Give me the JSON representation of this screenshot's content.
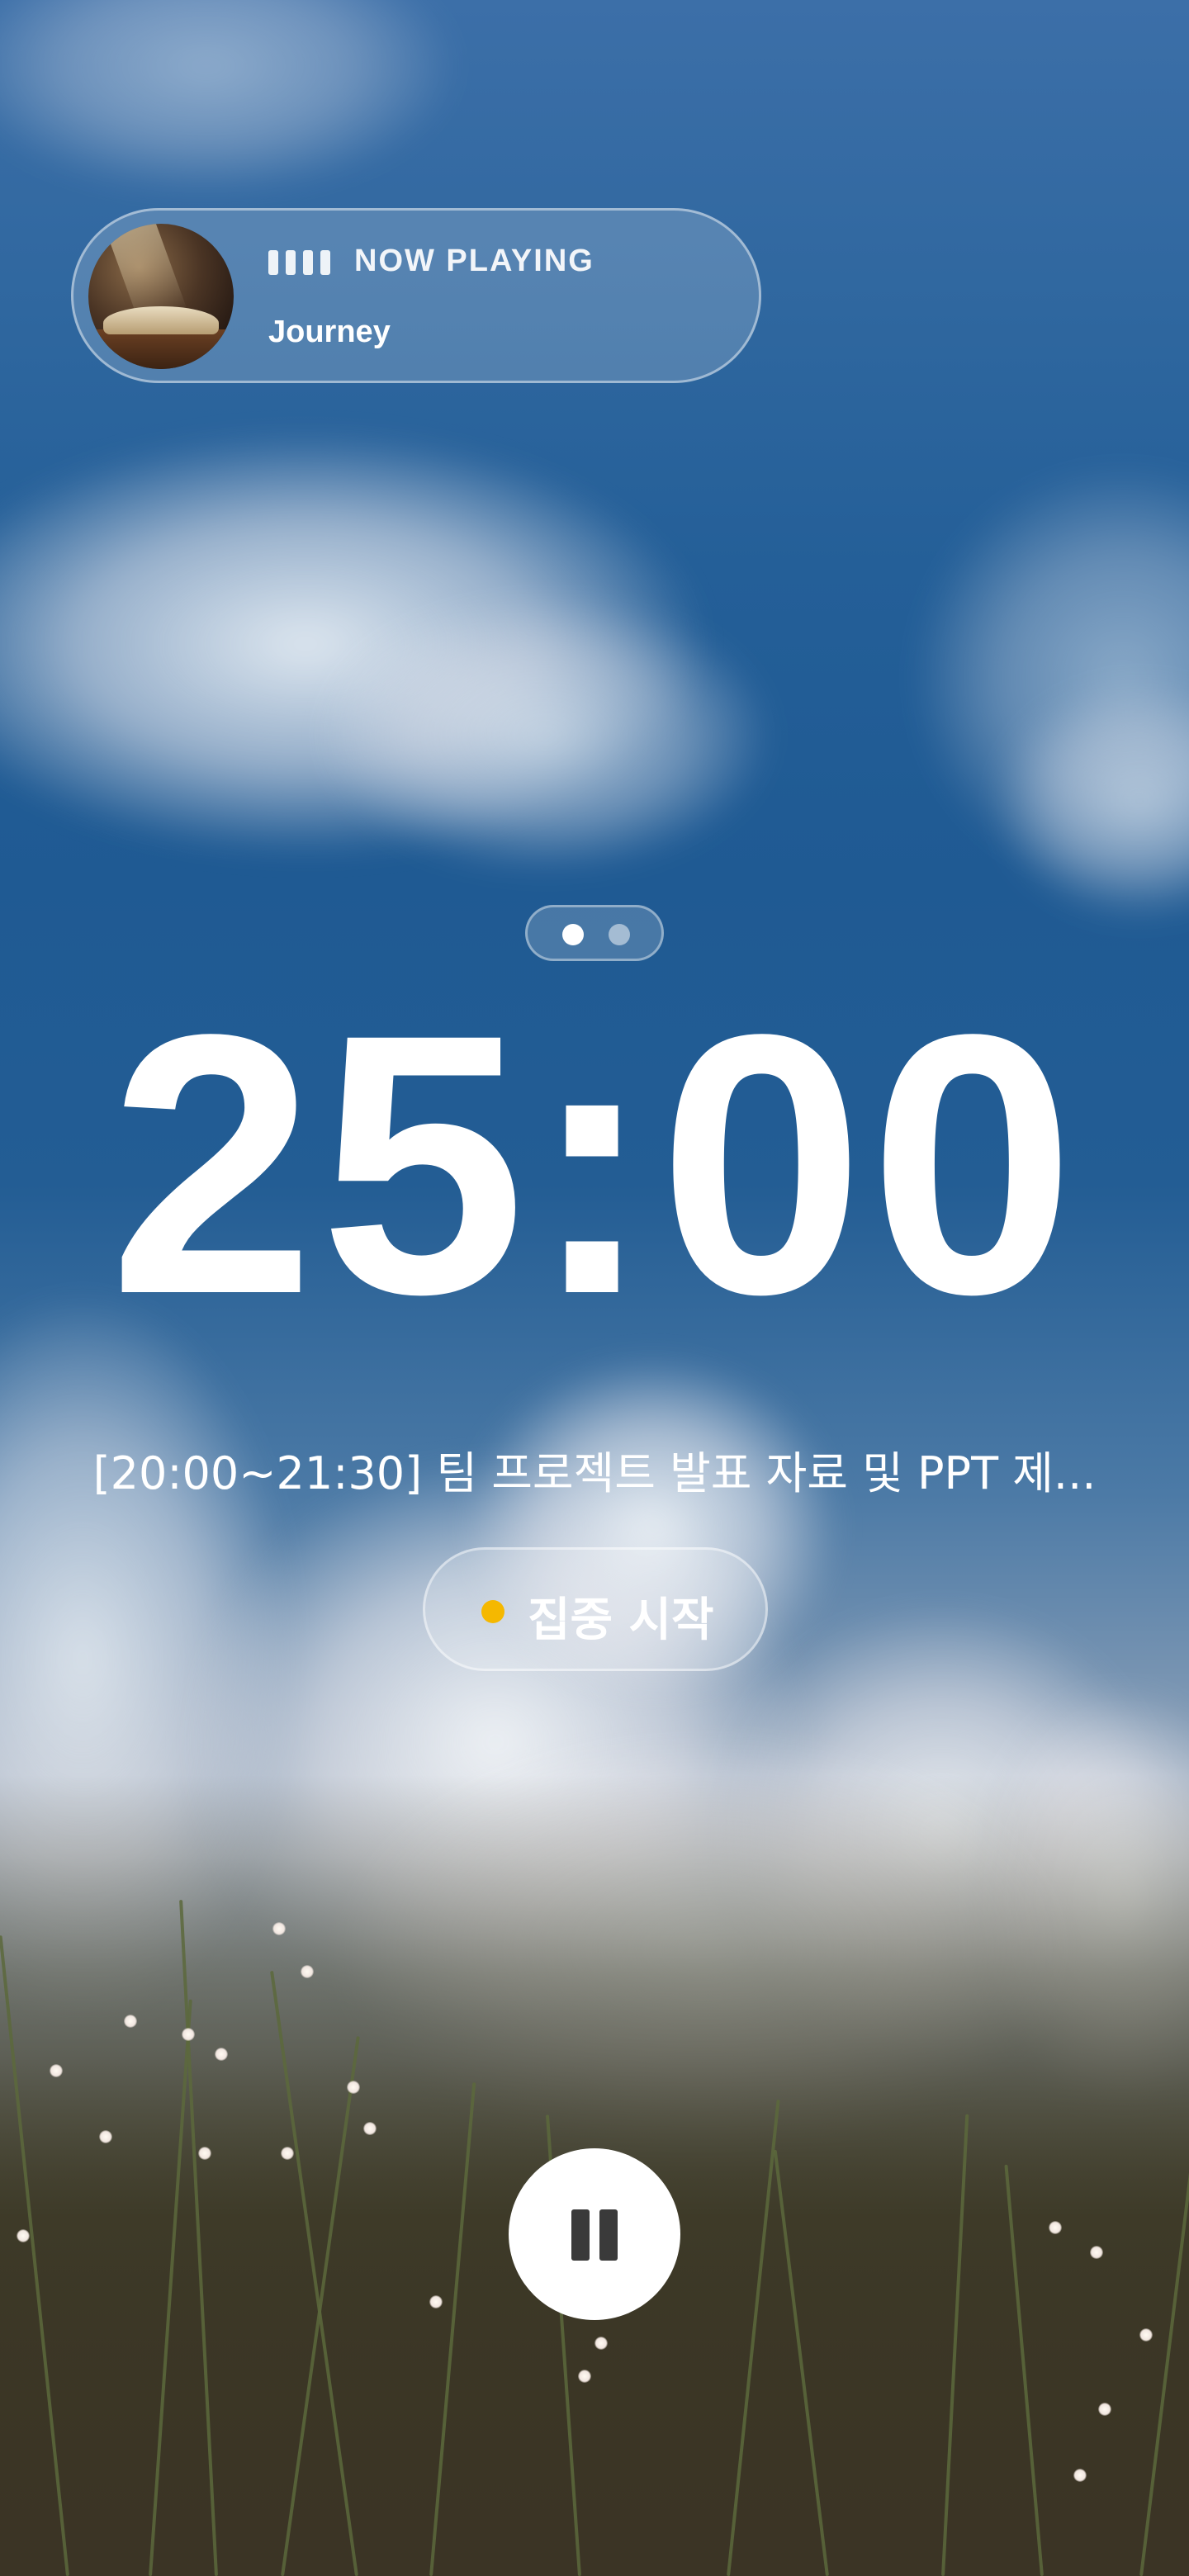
{
  "now_playing": {
    "label": "NOW PLAYING",
    "track": "Journey",
    "icon": "equalizer-icon"
  },
  "page_indicator": {
    "pages": 2,
    "active_page": 1
  },
  "timer": {
    "display": "25:00"
  },
  "task": {
    "text": "[20:00~21:30] 팀 프로젝트 발표 자료 및 PPT 제..."
  },
  "focus_button": {
    "label": "집중 시작",
    "dot_color": "#f5b800"
  },
  "controls": {
    "pause_icon": "pause-icon"
  }
}
